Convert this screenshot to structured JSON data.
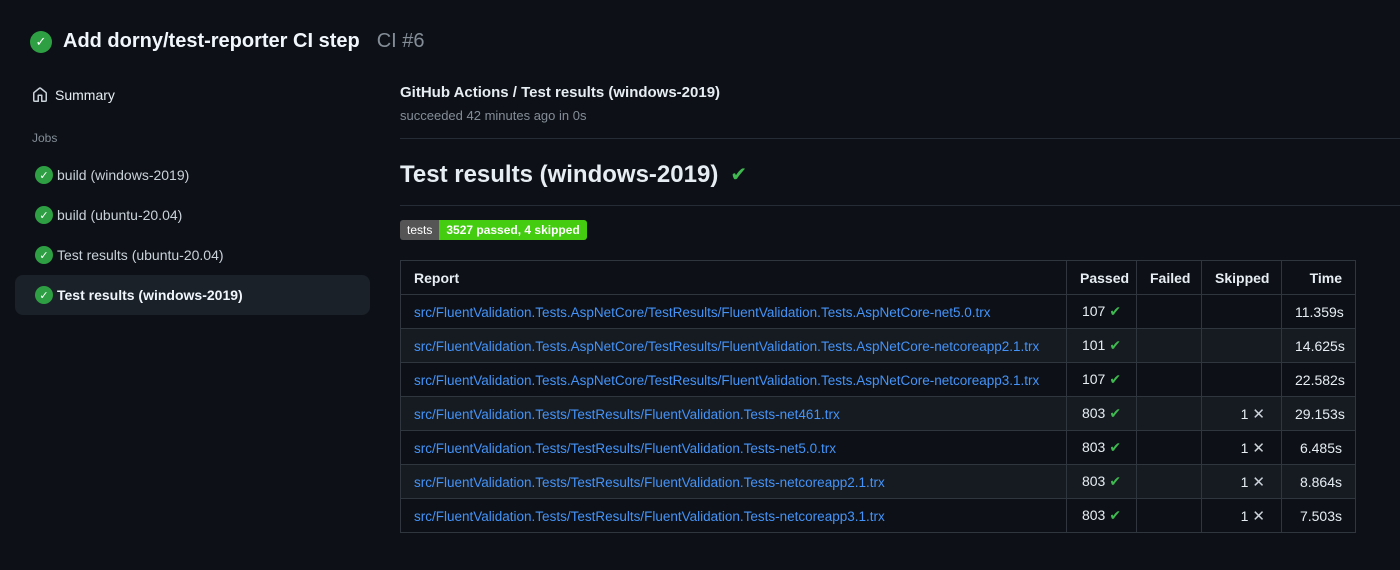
{
  "header": {
    "title": "Add dorny/test-reporter CI step",
    "run_number": "CI #6",
    "status": "success"
  },
  "sidebar": {
    "summary_label": "Summary",
    "jobs_label": "Jobs",
    "jobs": [
      {
        "label": "build (windows-2019)",
        "status": "success",
        "selected": false
      },
      {
        "label": "build (ubuntu-20.04)",
        "status": "success",
        "selected": false
      },
      {
        "label": "Test results (ubuntu-20.04)",
        "status": "success",
        "selected": false
      },
      {
        "label": "Test results (windows-2019)",
        "status": "success",
        "selected": true
      }
    ]
  },
  "main": {
    "check_title": "GitHub Actions / Test results (windows-2019)",
    "check_status": "succeeded 42 minutes ago in 0s",
    "section_title": "Test results (windows-2019)",
    "badge": {
      "label": "tests",
      "value": "3527 passed, 4 skipped",
      "label_bg": "#555555",
      "value_bg": "#44cc11"
    },
    "table": {
      "columns": [
        "Report",
        "Passed",
        "Failed",
        "Skipped",
        "Time"
      ],
      "rows": [
        {
          "report": "src/FluentValidation.Tests.AspNetCore/TestResults/FluentValidation.Tests.AspNetCore-net5.0.trx",
          "passed": "107",
          "failed": "",
          "skipped": "",
          "time": "11.359s"
        },
        {
          "report": "src/FluentValidation.Tests.AspNetCore/TestResults/FluentValidation.Tests.AspNetCore-netcoreapp2.1.trx",
          "passed": "101",
          "failed": "",
          "skipped": "",
          "time": "14.625s"
        },
        {
          "report": "src/FluentValidation.Tests.AspNetCore/TestResults/FluentValidation.Tests.AspNetCore-netcoreapp3.1.trx",
          "passed": "107",
          "failed": "",
          "skipped": "",
          "time": "22.582s"
        },
        {
          "report": "src/FluentValidation.Tests/TestResults/FluentValidation.Tests-net461.trx",
          "passed": "803",
          "failed": "",
          "skipped": "1",
          "time": "29.153s"
        },
        {
          "report": "src/FluentValidation.Tests/TestResults/FluentValidation.Tests-net5.0.trx",
          "passed": "803",
          "failed": "",
          "skipped": "1",
          "time": "6.485s"
        },
        {
          "report": "src/FluentValidation.Tests/TestResults/FluentValidation.Tests-netcoreapp2.1.trx",
          "passed": "803",
          "failed": "",
          "skipped": "1",
          "time": "8.864s"
        },
        {
          "report": "src/FluentValidation.Tests/TestResults/FluentValidation.Tests-netcoreapp3.1.trx",
          "passed": "803",
          "failed": "",
          "skipped": "1",
          "time": "7.503s"
        }
      ]
    }
  },
  "icons": {
    "success_check": "✓",
    "pass_check": "✔",
    "skip_x": "✕"
  },
  "colors": {
    "background": "#0d1117",
    "success_green": "#2ea043",
    "bright_green": "#3fb950",
    "link_blue": "#4493f8",
    "muted_text": "#848d97",
    "row_stripe": "#161b22",
    "border": "#30363d",
    "selected_item_bg": "#1b2129"
  }
}
